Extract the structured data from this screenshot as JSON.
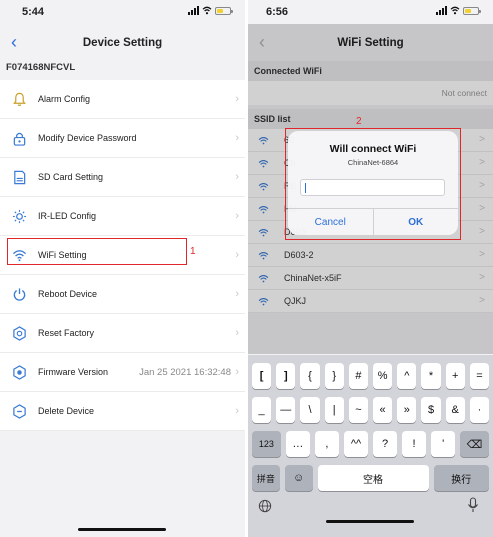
{
  "left_screen": {
    "status_time": "5:44",
    "nav_title": "Device Setting",
    "back_glyph": "‹",
    "device_id": "F074168NFCVL",
    "battery_color": "#f2d22e",
    "menu": [
      {
        "label": "Alarm Config",
        "icon": "bell-icon"
      },
      {
        "label": "Modify Device Password",
        "icon": "lock-icon"
      },
      {
        "label": "SD Card Setting",
        "icon": "sd-card-icon"
      },
      {
        "label": "IR-LED Config",
        "icon": "sun-icon"
      },
      {
        "label": "WiFi Setting",
        "icon": "wifi-icon"
      },
      {
        "label": "Reboot Device",
        "icon": "power-icon"
      },
      {
        "label": "Reset Factory",
        "icon": "reset-icon"
      },
      {
        "label": "Firmware Version",
        "icon": "firmware-icon",
        "value": "Jan 25 2021 16:32:48"
      },
      {
        "label": "Delete Device",
        "icon": "delete-icon"
      }
    ],
    "chevron": "›",
    "highlight_number": "1"
  },
  "right_screen": {
    "status_time": "6:56",
    "nav_title": "WiFi Setting",
    "back_glyph": "‹",
    "battery_color": "#f2d22e",
    "connected_header": "Connected WiFi",
    "not_connected": "Not connect",
    "ssid_header": "SSID list",
    "ssids": [
      "60",
      "Ch",
      "RE",
      "HU",
      "D603",
      "D603-2",
      "ChinaNet-x5iF",
      "QJKJ"
    ],
    "chevron": ">",
    "highlight_number": "2",
    "dialog": {
      "title": "Will connect WiFi",
      "message": "ChinaNet-6864",
      "cancel": "Cancel",
      "ok": "OK"
    },
    "keyboard": {
      "row1": [
        "[",
        "]",
        "{",
        "}",
        "#",
        "%",
        "^",
        "*",
        "+",
        "="
      ],
      "row2": [
        "_",
        "—",
        "\\",
        "|",
        "~",
        "«",
        "»",
        "$",
        "&",
        "·"
      ],
      "row3": [
        "123",
        "…",
        ",",
        "^^",
        "?",
        "!",
        "'",
        "⌫"
      ],
      "row4": [
        "拼音",
        "☺",
        "空格",
        "换行"
      ]
    }
  },
  "colors": {
    "accent_blue": "#2d6fd8",
    "highlight_red": "#e0262a"
  }
}
